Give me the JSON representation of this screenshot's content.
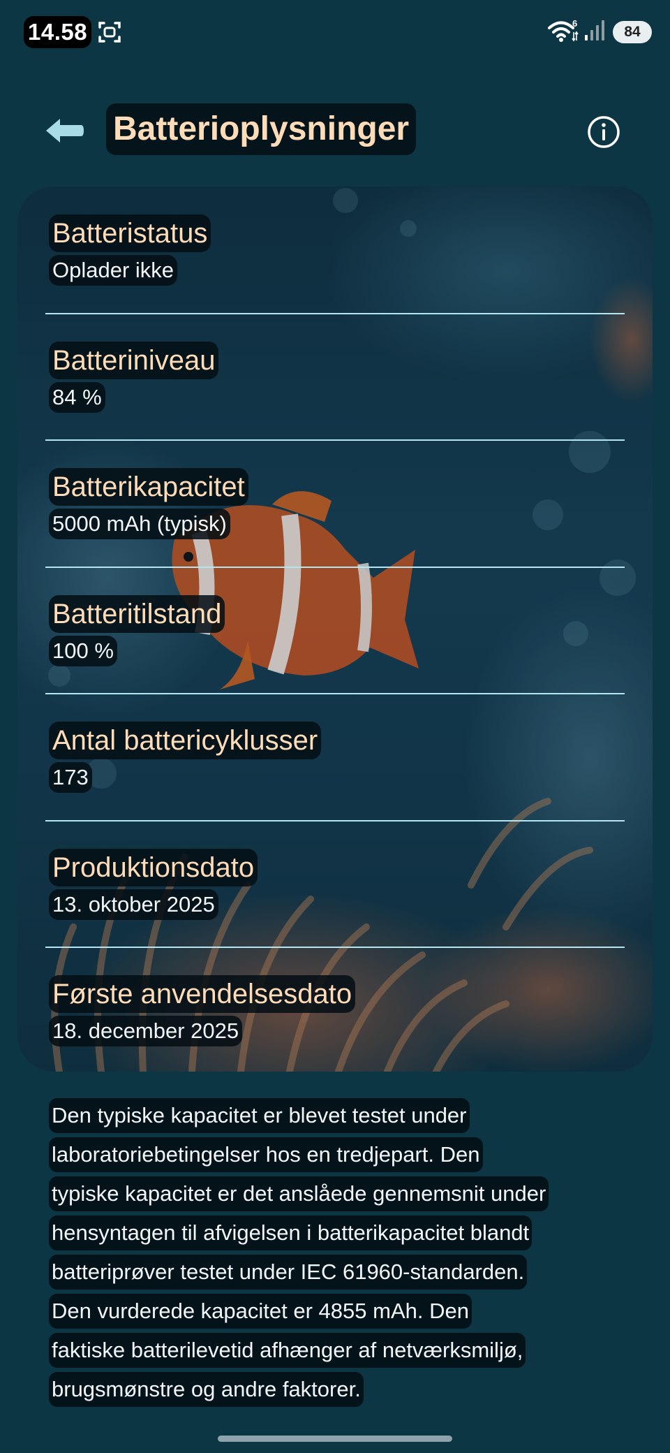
{
  "status_bar": {
    "time": "14.58",
    "battery": "84",
    "wifi_badge": "6"
  },
  "header": {
    "title": "Batterioplysninger"
  },
  "rows": [
    {
      "label": "Batteristatus",
      "value": "Oplader ikke"
    },
    {
      "label": "Batteriniveau",
      "value": "84 %"
    },
    {
      "label": "Batterikapacitet",
      "value": "5000 mAh (typisk)"
    },
    {
      "label": "Batteritilstand",
      "value": "100 %"
    },
    {
      "label": "Antal battericyklusser",
      "value": "173"
    },
    {
      "label": "Produktionsdato",
      "value": "13. oktober 2025"
    },
    {
      "label": "Første anvendelsesdato",
      "value": "18. december 2025"
    }
  ],
  "note": [
    "Den typiske kapacitet er blevet testet under",
    "laboratoriebetingelser hos en tredjepart. Den",
    "typiske kapacitet er det anslåede gennemsnit under",
    "hensyntagen til afvigelsen i batterikapacitet blandt",
    "batteriprøver testet under IEC 61960-standarden.",
    "Den vurderede kapacitet er 4855 mAh. Den",
    "faktiske batterilevetid afhænger af netværksmiljø,",
    "brugsmønstre og andre faktorer."
  ],
  "icons": {
    "back": "back-arrow-icon",
    "info": "info-icon",
    "screenshot": "screenshot-icon",
    "wifi": "wifi-icon",
    "signal": "signal-icon"
  },
  "colors": {
    "background": "#0d3645",
    "label": "#ffdcb8",
    "divider": "#b3e6f0",
    "back_arrow": "#a9dbe6"
  }
}
